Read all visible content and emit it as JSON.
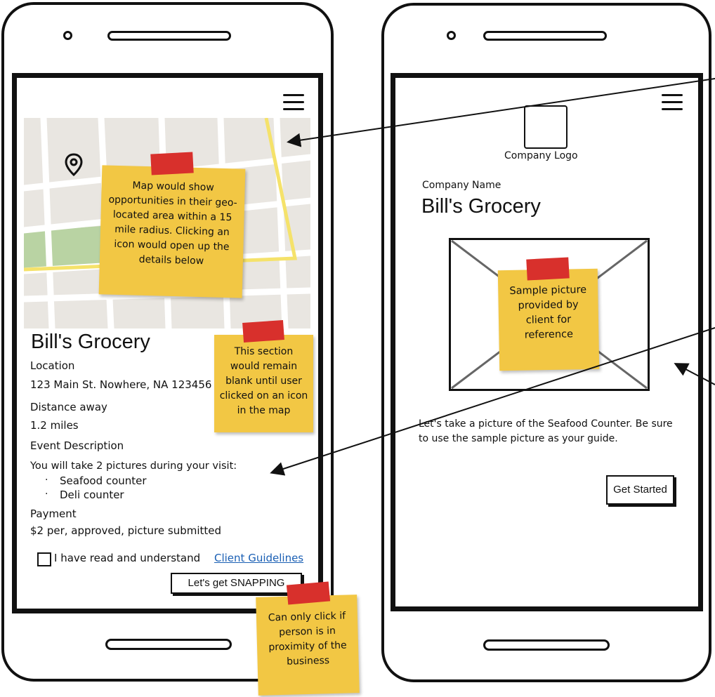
{
  "left_phone": {
    "map_note": "Map would show opportunities in their geo-located area within a 15 mile radius. Clicking an icon would open up the details below",
    "title": "Bill's Grocery",
    "location_label": "Location",
    "location_value": "123 Main St. Nowhere, NA 123456",
    "distance_label": "Distance away",
    "distance_value": "1.2 miles",
    "event_label": "Event Description",
    "event_intro": "You will take 2 pictures during your visit:",
    "event_items": [
      "Seafood counter",
      "Deli counter"
    ],
    "payment_label": "Payment",
    "payment_value": "$2 per, approved, picture submitted",
    "checkbox_label": "I have read and understand",
    "guidelines_link": "Client Guidelines",
    "cta_button": "Let's get SNAPPING",
    "section_note": "This section would remain blank until user clicked on an icon in the map",
    "cta_note": "Can only click if person is in proximity of the business"
  },
  "right_phone": {
    "logo_label": "Company Logo",
    "company_name_label": "Company Name",
    "company_name": "Bill's Grocery",
    "picture_note": "Sample picture provided by client for reference",
    "instruction": "Let's take a picture of the Seafood Counter. Be sure to use the sample picture as your guide.",
    "start_button": "Get Started"
  },
  "colors": {
    "sticky": "#f2c744",
    "tape": "#d8302c",
    "map_bg": "#e9e6e1",
    "map_road": "#ffffff",
    "map_park": "#b9d3a3",
    "map_highway": "#f5e26a",
    "link": "#1a5fb4"
  },
  "icons": [
    "hamburger-menu-icon",
    "map-pin-icon",
    "checkbox-icon",
    "image-placeholder-icon"
  ]
}
